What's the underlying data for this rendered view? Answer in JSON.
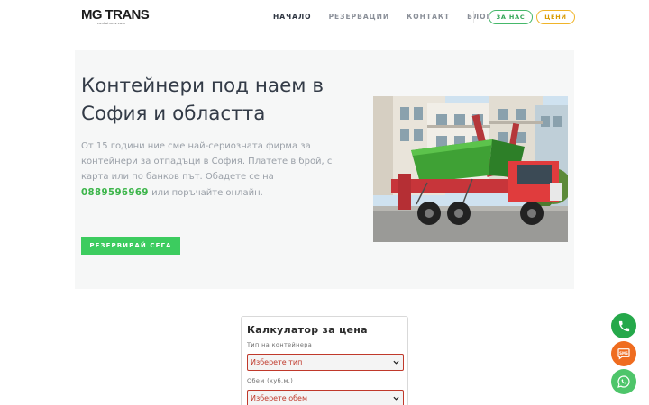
{
  "brand": {
    "logo_main": "MG TRANS",
    "logo_sub": "containers.com"
  },
  "nav": {
    "items": [
      {
        "label": "НАЧАЛО",
        "active": true
      },
      {
        "label": "РЕЗЕРВАЦИИ",
        "active": false
      },
      {
        "label": "КОНТАКТ",
        "active": false
      },
      {
        "label": "БЛОГ",
        "active": false
      }
    ],
    "about_label": "ЗА НАС",
    "prices_label": "ЦЕНИ"
  },
  "hero": {
    "title": "Контейнери под наем в София и областта",
    "text_before": "От 15 години ние сме най-сериозната фирма за контейнери за отпадъци в София. Платете в брой, с карта или по банков път. Обадете се на ",
    "phone": "0889596969",
    "text_after": " или поръчайте онлайн.",
    "cta_label": "РЕЗЕРВИРАЙ СЕГА"
  },
  "calculator": {
    "title": "Калкулатор за цена",
    "type_label": "Тип на контейнера",
    "type_value": "Изберете тип",
    "volume_label": "Обем (куб.м.)",
    "volume_value": "Изберете обем"
  },
  "floating": {
    "sms_label": "SMS"
  },
  "colors": {
    "accent_green": "#3ccc5f",
    "phone_green": "#3cb54a",
    "error_red": "#c0392b",
    "sms_orange": "#ef6c1f"
  }
}
